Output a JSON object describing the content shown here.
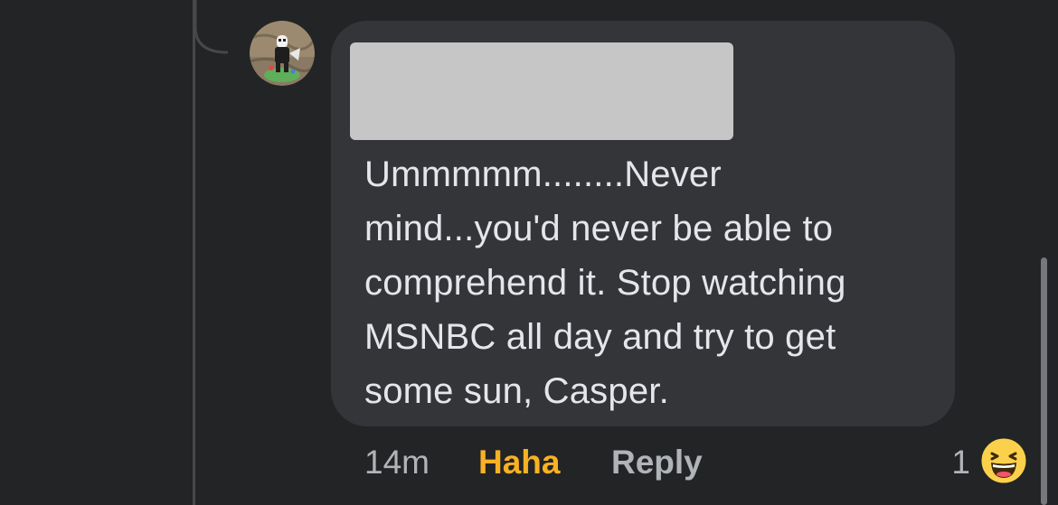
{
  "comment": {
    "avatar_icon": "user-avatar",
    "author_name": "[redacted]",
    "text_lines": [
      "Ummmmm........Never",
      "mind...you'd never be able to",
      "comprehend it. Stop watching",
      "MSNBC all day and try to get",
      "some sun, Casper."
    ],
    "actions": {
      "timestamp": "14m",
      "reaction_label": "Haha",
      "reply_label": "Reply"
    },
    "reactions": {
      "count": "1",
      "icon": "haha-emoji-icon"
    }
  },
  "colors": {
    "background": "#232425",
    "bubble": "#343538",
    "text": "#e4e6eb",
    "secondary_text": "#b0b3b8",
    "haha_accent": "#f7b125"
  }
}
